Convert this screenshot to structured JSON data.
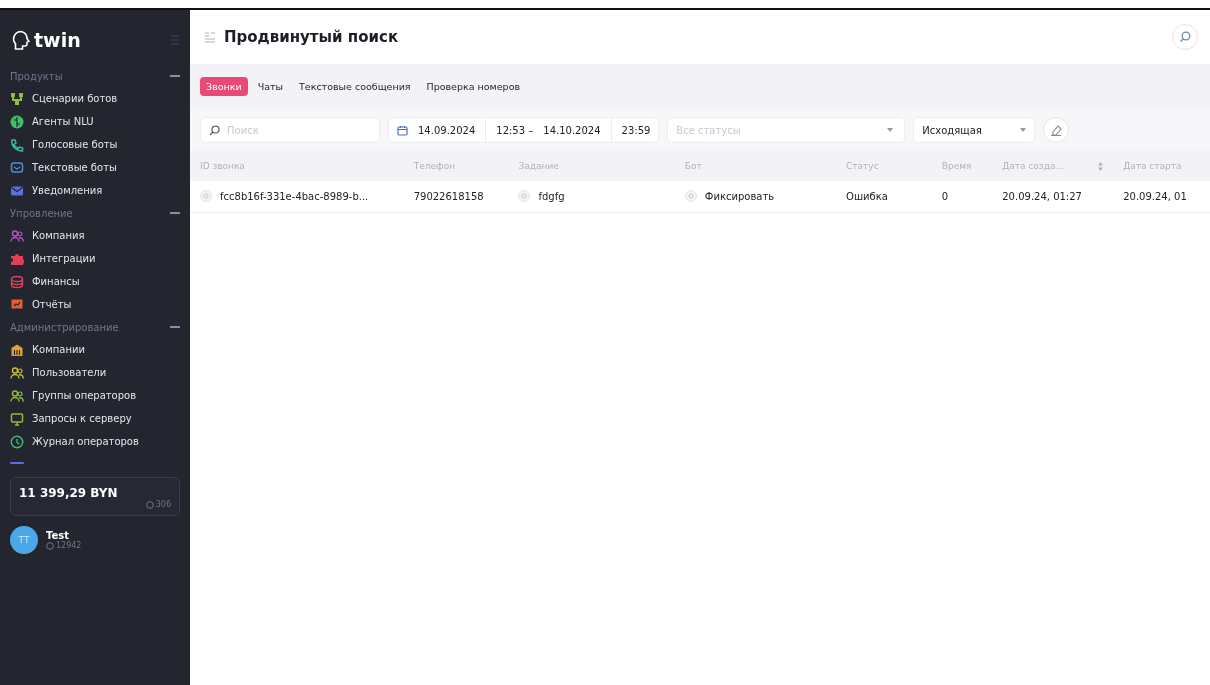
{
  "sidebar": {
    "logo": "twin",
    "sections": [
      {
        "title": "Продукты",
        "expanded": true,
        "items": [
          {
            "label": "Сценарии ботов",
            "color": "#8fbf3a"
          },
          {
            "label": "Агенты NLU",
            "color": "#3fbf6a"
          },
          {
            "label": "Голосовые боты",
            "color": "#38b6a8"
          },
          {
            "label": "Текстовые боты",
            "color": "#4a90e2"
          },
          {
            "label": "Уведомления",
            "color": "#5b6fe0"
          }
        ]
      },
      {
        "title": "Упровление",
        "expanded": true,
        "items": [
          {
            "label": "Компания",
            "color": "#c44fc4"
          },
          {
            "label": "Интеграции",
            "color": "#e0405a"
          },
          {
            "label": "Финансы",
            "color": "#e0405a"
          },
          {
            "label": "Отчёты",
            "color": "#e2622a"
          }
        ]
      },
      {
        "title": "Администрирование",
        "expanded": true,
        "items": [
          {
            "label": "Компании",
            "color": "#e0a030"
          },
          {
            "label": "Пользователи",
            "color": "#c8c03a"
          },
          {
            "label": "Группы операторов",
            "color": "#8fbf3a"
          },
          {
            "label": "Запросы к серверу",
            "color": "#8fbf3a"
          },
          {
            "label": "Журнал операторов",
            "color": "#3fbf6a"
          }
        ]
      }
    ],
    "balance": {
      "amount": "11 399,29 BYN",
      "count": "306"
    },
    "user": {
      "initials": "TT",
      "name": "Test",
      "id": "12942"
    }
  },
  "header": {
    "title": "Продвинутый поиск"
  },
  "tabs": [
    {
      "label": "Звонки",
      "selected": true
    },
    {
      "label": "Чаты",
      "selected": false
    },
    {
      "label": "Текстовые сообщения",
      "selected": false
    },
    {
      "label": "Проверка номеров",
      "selected": false
    }
  ],
  "filters": {
    "search": {
      "placeholder": "Поиск"
    },
    "date_from": "14.09.2024",
    "time_from": "12:53",
    "separator": "–",
    "date_to": "14.10.2024",
    "time_to": "23:59",
    "status": {
      "placeholder": "Все статусы"
    },
    "direction": {
      "value": "Исходящая"
    }
  },
  "table": {
    "columns": [
      {
        "label": "ID звонка",
        "sortable": false
      },
      {
        "label": "Телефон",
        "sortable": false
      },
      {
        "label": "Задание",
        "sortable": false
      },
      {
        "label": "Бот",
        "sortable": false
      },
      {
        "label": "Статус",
        "sortable": false
      },
      {
        "label": "Время",
        "sortable": false
      },
      {
        "label": "Дата созда...",
        "sortable": true
      },
      {
        "label": "Дата старта",
        "sortable": false
      }
    ],
    "rows": [
      [
        "fcc8b16f-331e-4bac-8989-b...",
        "79022618158",
        "fdgfg",
        "Фиксировать",
        "Ошибка",
        "0",
        "20.09.24, 01:27",
        "20.09.24, 01"
      ]
    ]
  }
}
